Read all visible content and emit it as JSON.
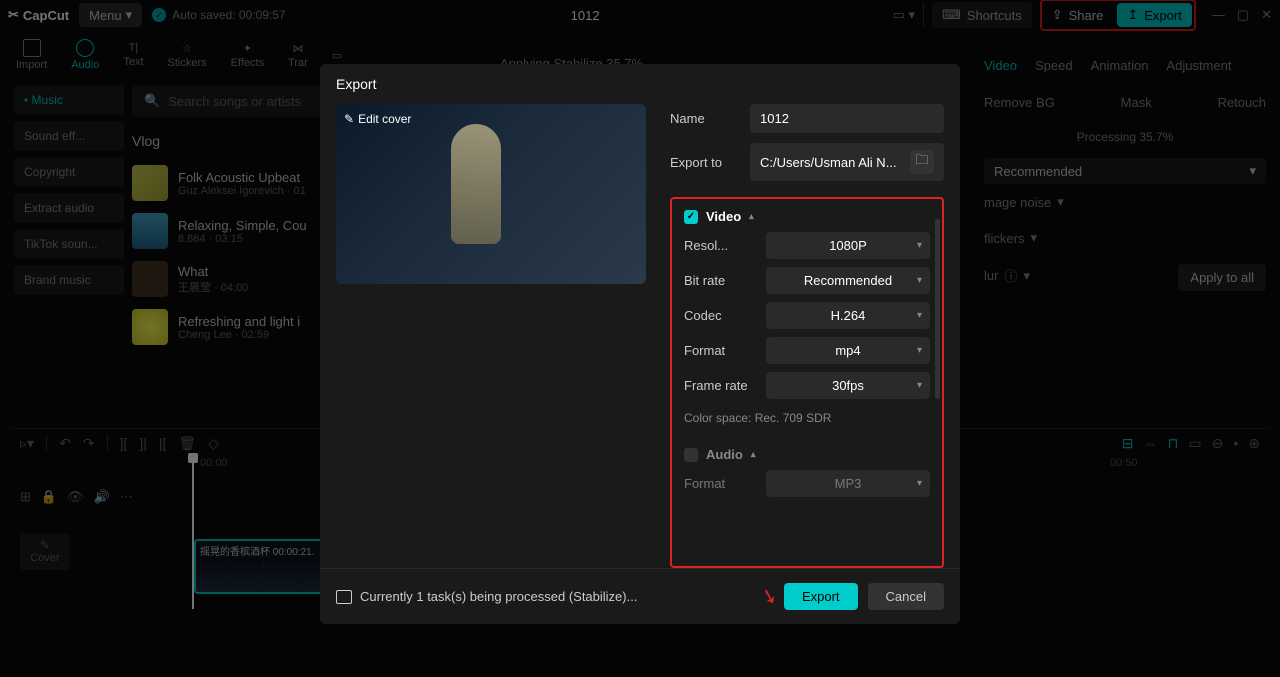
{
  "topbar": {
    "app_name": "CapCut",
    "menu_label": "Menu",
    "autosave": "Auto saved: 00:09:57",
    "title": "1012",
    "shortcuts": "Shortcuts",
    "share": "Share",
    "export": "Export"
  },
  "tools": {
    "import": "Import",
    "audio": "Audio",
    "text": "Text",
    "stickers": "Stickers",
    "effects": "Effects",
    "transitions": "Trar"
  },
  "stage": {
    "applying": "Applying Stabilize   35.7%"
  },
  "sidebar": {
    "items": [
      "Music",
      "Sound eff...",
      "Copyright",
      "Extract audio",
      "TikTok soun...",
      "Brand music"
    ]
  },
  "search": {
    "placeholder": "Search songs or artists"
  },
  "vlog": {
    "label": "Vlog"
  },
  "songs": [
    {
      "title": "Folk Acoustic Upbeat",
      "sub": "Guz Aleksei Igorevich · 01"
    },
    {
      "title": "Relaxing, Simple, Cou",
      "sub": "8.864 · 03:15"
    },
    {
      "title": "What",
      "sub": "王晨莹 · 04:00"
    },
    {
      "title": "Refreshing and light i",
      "sub": "Cheng Lee · 02:59"
    }
  ],
  "right_panel": {
    "tabs": [
      "Video",
      "Speed",
      "Animation",
      "Adjustment"
    ],
    "row_tabs": [
      "Remove BG",
      "Mask",
      "Retouch"
    ],
    "processing": "Processing 35.7%",
    "recommended": "Recommended",
    "noise": "mage noise",
    "flickers": "flickers",
    "blur": "lur",
    "apply": "Apply to all"
  },
  "timeline": {
    "times": [
      "00:00",
      "00:50"
    ],
    "clip_label": "摇晃的香槟酒杯   00:00:21.",
    "cover": "Cover"
  },
  "dialog": {
    "title": "Export",
    "edit_cover": "Edit cover",
    "name_label": "Name",
    "name_value": "1012",
    "export_to_label": "Export to",
    "export_to_value": "C:/Users/Usman Ali N...",
    "video_label": "Video",
    "audio_label": "Audio",
    "rows": {
      "resolution": {
        "label": "Resol...",
        "value": "1080P"
      },
      "bitrate": {
        "label": "Bit rate",
        "value": "Recommended"
      },
      "codec": {
        "label": "Codec",
        "value": "H.264"
      },
      "format": {
        "label": "Format",
        "value": "mp4"
      },
      "framerate": {
        "label": "Frame rate",
        "value": "30fps"
      },
      "audio_format": {
        "label": "Format",
        "value": "MP3"
      }
    },
    "colorspace": "Color space: Rec. 709 SDR",
    "footer_task": "Currently 1 task(s) being processed (Stabilize)...",
    "export_btn": "Export",
    "cancel_btn": "Cancel"
  }
}
